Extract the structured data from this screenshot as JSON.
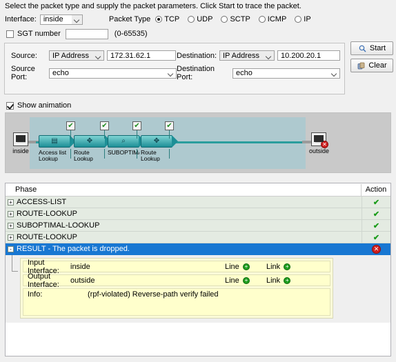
{
  "instruction": "Select the packet type and supply the packet parameters. Click Start to trace the packet.",
  "form": {
    "interface_label": "Interface:",
    "interface_value": "inside",
    "packet_type_label": "Packet Type",
    "packet_types": [
      {
        "label": "TCP",
        "selected": true
      },
      {
        "label": "UDP",
        "selected": false
      },
      {
        "label": "SCTP",
        "selected": false
      },
      {
        "label": "ICMP",
        "selected": false
      },
      {
        "label": "IP",
        "selected": false
      }
    ],
    "sgt_label": "SGT number",
    "sgt_checked": false,
    "sgt_value": "",
    "sgt_range": "(0-65535)",
    "source_label": "Source:",
    "source_type": "IP Address",
    "source_value": "172.31.62.1",
    "destination_label": "Destination:",
    "destination_type": "IP Address",
    "destination_value": "10.200.20.1",
    "source_port_label": "Source Port:",
    "source_port_value": "echo",
    "destination_port_label": "Destination Port:",
    "destination_port_value": "echo"
  },
  "buttons": {
    "start": "Start",
    "clear": "Clear"
  },
  "animation": {
    "show_label": "Show animation",
    "show_checked": true,
    "ingress_interface": "inside",
    "egress_interface": "outside",
    "stages": [
      {
        "label_line1": "Access list",
        "label_line2": "Lookup",
        "glyph": "acl-icon",
        "status": "pass"
      },
      {
        "label_line1": "Route",
        "label_line2": "Lookup",
        "glyph": "route-icon",
        "status": "pass"
      },
      {
        "label_line1": "SUBOPTIMA",
        "label_line2": "",
        "glyph": "lookup-icon",
        "status": "pass"
      },
      {
        "label_line1": "Route",
        "label_line2": "Lookup",
        "glyph": "route-icon",
        "status": "pass"
      }
    ]
  },
  "table": {
    "columns": [
      "Phase",
      "Action"
    ],
    "rows": [
      {
        "phase": "ACCESS-LIST",
        "expander": "+",
        "action": "pass",
        "selected": false
      },
      {
        "phase": "ROUTE-LOOKUP",
        "expander": "+",
        "action": "pass",
        "selected": false
      },
      {
        "phase": "SUBOPTIMAL-LOOKUP",
        "expander": "+",
        "action": "pass",
        "selected": false
      },
      {
        "phase": "ROUTE-LOOKUP",
        "expander": "+",
        "action": "pass",
        "selected": false
      },
      {
        "phase": "RESULT - The packet is dropped.",
        "expander": "-",
        "action": "drop",
        "selected": true
      }
    ]
  },
  "detail": {
    "input_label": "Input Interface:",
    "input_value": "inside",
    "output_label": "Output Interface:",
    "output_value": "outside",
    "line_label": "Line",
    "link_label": "Link",
    "info_label": "Info:",
    "info_value": "(rpf-violated) Reverse-path verify failed"
  },
  "colors": {
    "selection_blue": "#1877d2",
    "pass_green": "#1a9c1a",
    "drop_red": "#cf1f1f",
    "detail_yellow": "#ffffcc",
    "band_teal": "#aec9cf"
  }
}
